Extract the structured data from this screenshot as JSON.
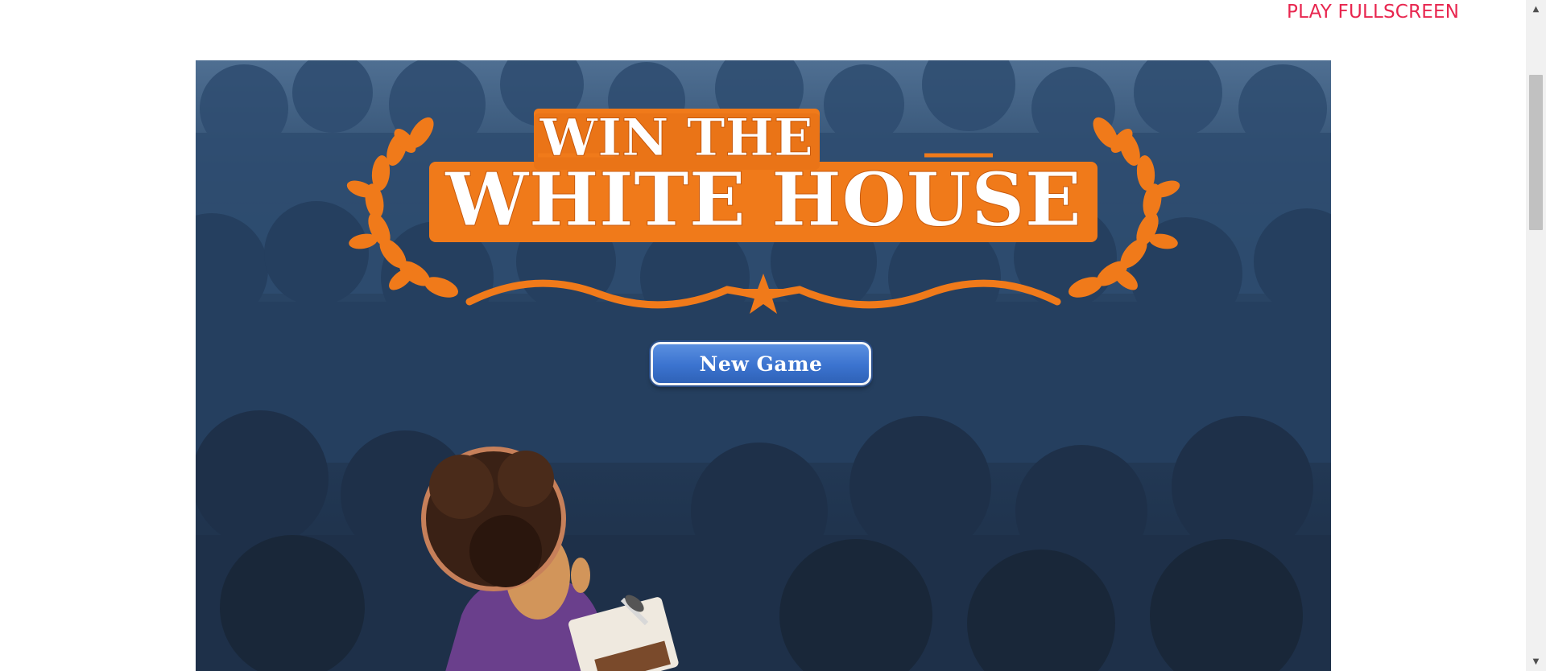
{
  "header": {
    "fullscreen_label": "PLAY FULLSCREEN",
    "link_color": "#e8264f"
  },
  "game": {
    "title_line1": "WIN THE",
    "title_line2": "WHITE HOUSE",
    "new_game_label": "New Game",
    "title_color": "#f07a1a",
    "button_color": "#3b73cf"
  },
  "scrollbar": {
    "up_glyph": "▲",
    "down_glyph": "▼"
  }
}
